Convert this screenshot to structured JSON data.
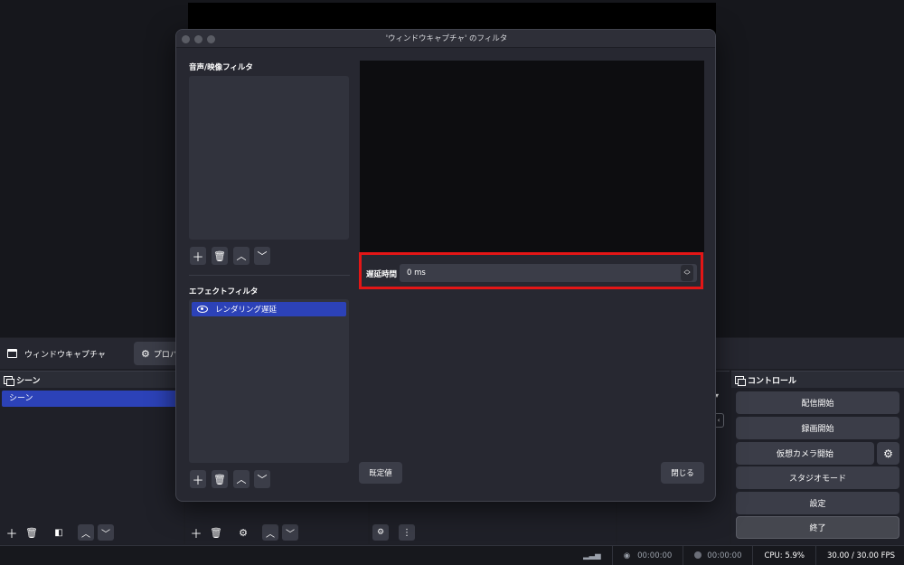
{
  "main": {
    "source_name": "ウィンドウキャプチャ",
    "properties_label": "プロパ",
    "scenes_title": "シーン",
    "scene_items": [
      "シーン"
    ],
    "controls_title": "コントロール",
    "controls": {
      "start_streaming": "配信開始",
      "start_recording": "録画開始",
      "start_virtual_camera": "仮想カメラ開始",
      "studio_mode": "スタジオモード",
      "settings": "設定",
      "exit": "終了"
    }
  },
  "status": {
    "stream_time": "00:00:00",
    "record_time": "00:00:00",
    "cpu": "CPU: 5.9%",
    "fps": "30.00 / 30.00 FPS"
  },
  "dialog": {
    "title": "'ウィンドウキャプチャ' のフィルタ",
    "audio_video_filters_label": "音声/映像フィルタ",
    "effect_filters_label": "エフェクトフィルタ",
    "effect_filters": [
      {
        "name": "レンダリング遅延",
        "visible": true
      }
    ],
    "delay_label": "遅延時間",
    "delay_value": "0 ms",
    "defaults_button": "既定値",
    "close_button": "閉じる"
  },
  "colors": {
    "accent": "#2c42b8",
    "highlight_border": "#e31616",
    "panel_bg": "#272831",
    "button_bg": "#3b3d48"
  }
}
